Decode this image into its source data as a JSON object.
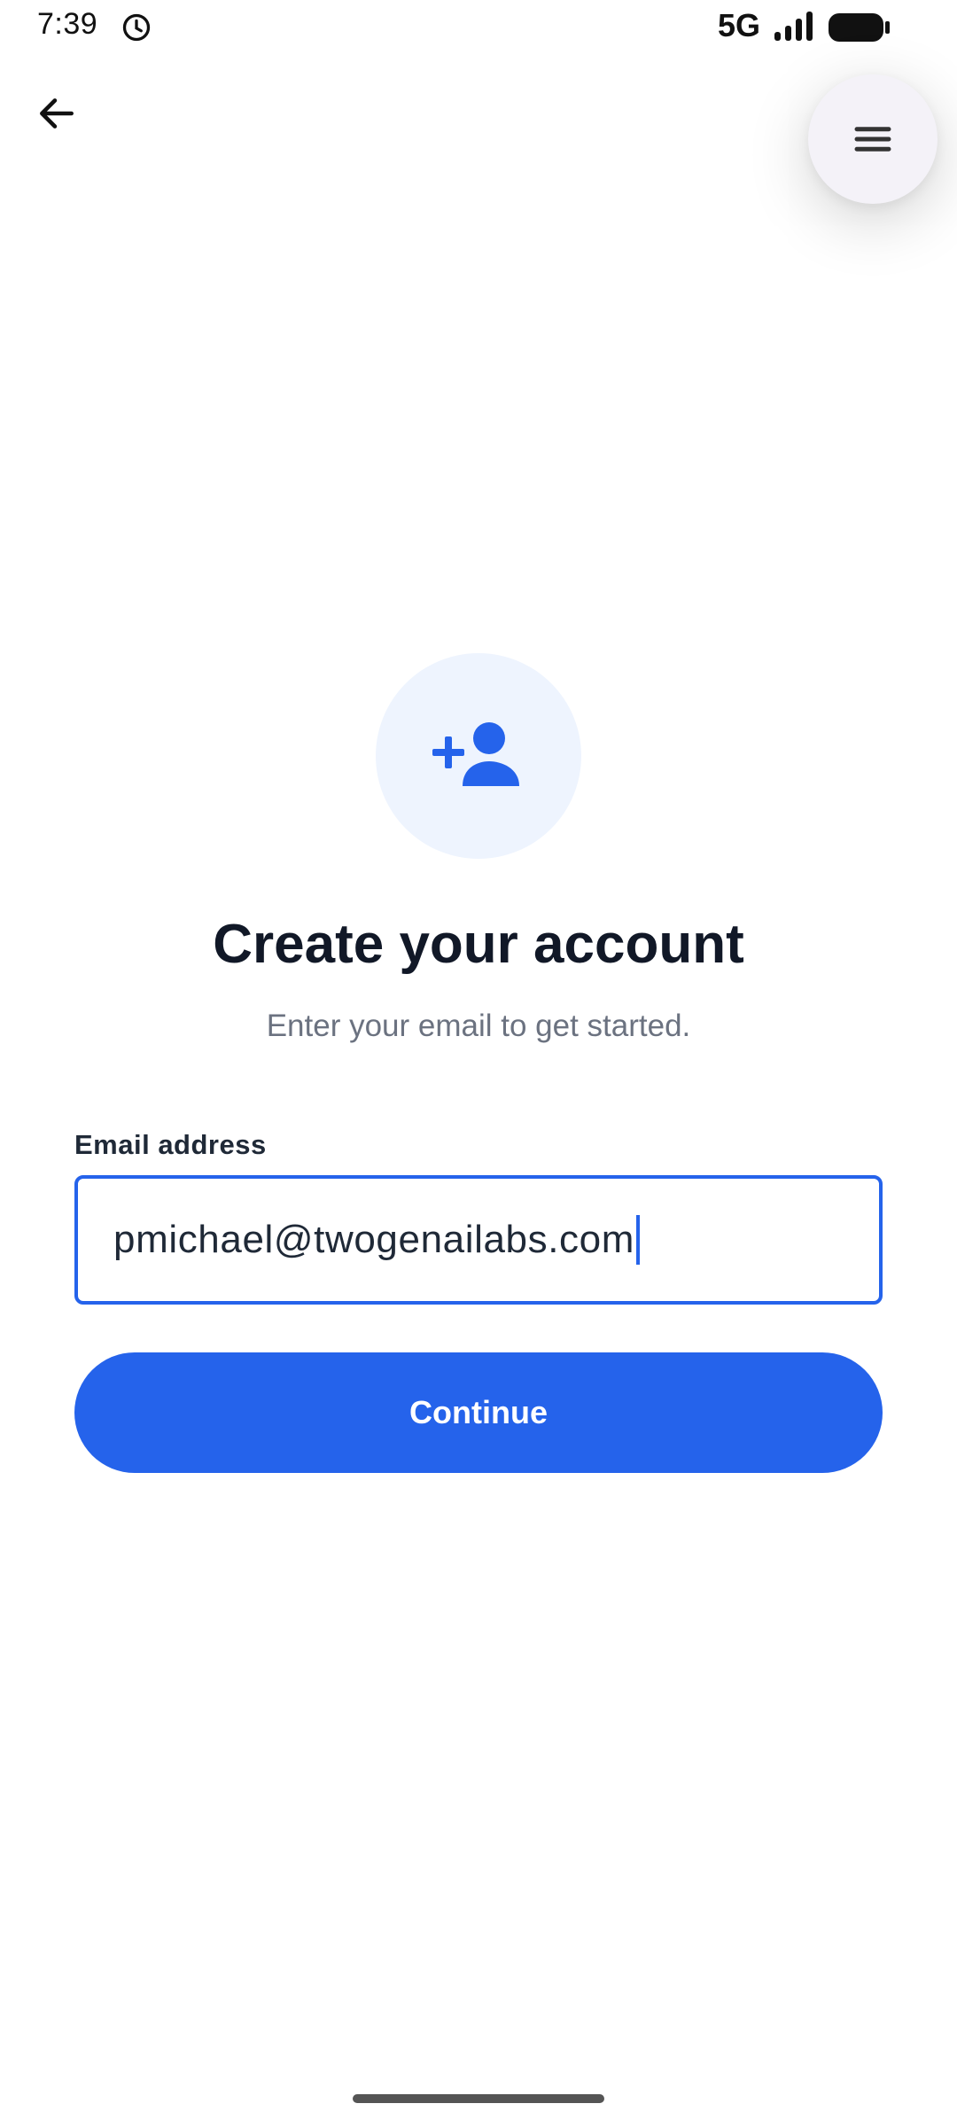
{
  "status_bar": {
    "time": "7:39",
    "network": "5G",
    "alarm_icon": "alarm-clock-icon",
    "signal_icon": "signal-bars-icon",
    "battery_icon": "battery-full-icon"
  },
  "toolbar": {
    "back_icon": "arrow-left-icon",
    "menu_icon": "hamburger-menu-icon"
  },
  "signup": {
    "icon": "person-add-icon",
    "title": "Create your account",
    "subtitle": "Enter your email to get started.",
    "email_label": "Email address",
    "email_value": "pmichael@twogenailabs.com",
    "continue_label": "Continue"
  },
  "colors": {
    "accent": "#2563eb",
    "accent_light": "#eef4fe",
    "title": "#111827",
    "subtitle": "#6b7280",
    "fab_background": "#f4f2f8"
  }
}
